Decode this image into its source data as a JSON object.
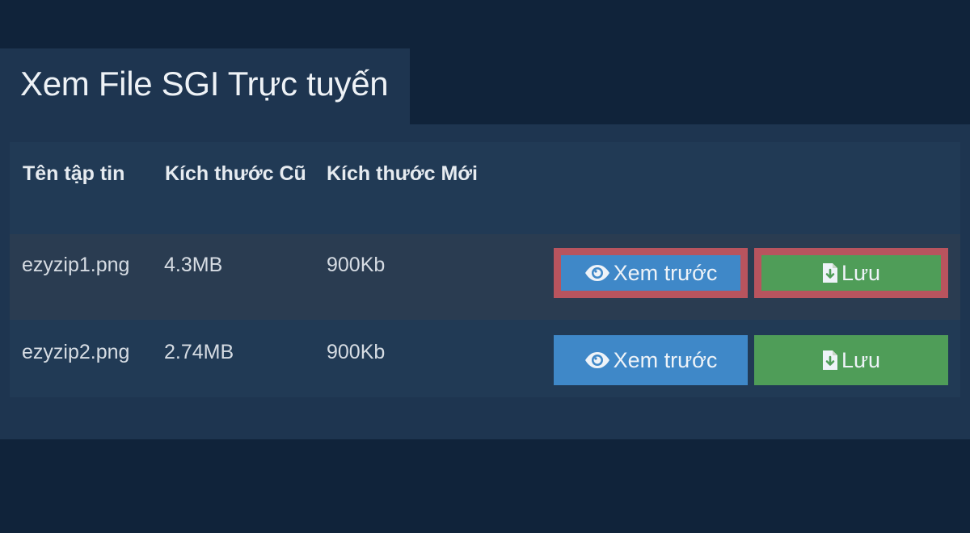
{
  "page": {
    "title": "Xem File SGI Trực tuyến"
  },
  "table": {
    "headers": {
      "name": "Tên tập tin",
      "old_size": "Kích thước Cũ",
      "new_size": "Kích thước Mới"
    },
    "rows": [
      {
        "name": "ezyzip1.png",
        "old_size": "4.3MB",
        "new_size": "900Kb",
        "preview_label": "Xem trước",
        "save_label": "Lưu",
        "highlighted": true
      },
      {
        "name": "ezyzip2.png",
        "old_size": "2.74MB",
        "new_size": "900Kb",
        "preview_label": "Xem trước",
        "save_label": "Lưu",
        "highlighted": false
      }
    ]
  },
  "colors": {
    "background": "#10233a",
    "panel": "#1e3550",
    "preview_button": "#3f88c8",
    "save_button": "#4f9d58",
    "highlight_border": "#b8545e"
  },
  "icons": {
    "preview": "eye-icon",
    "save": "file-download-icon"
  }
}
